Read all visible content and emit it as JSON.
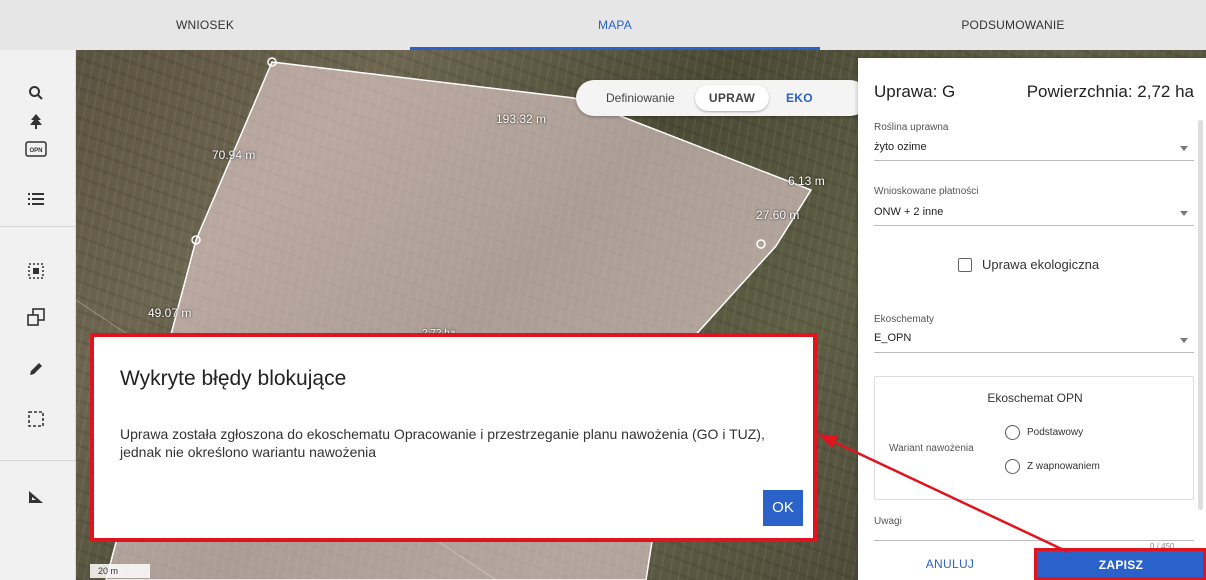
{
  "tabs": [
    {
      "label": "WNIOSEK"
    },
    {
      "label": "MAPA"
    },
    {
      "label": "PODSUMOWANIE"
    }
  ],
  "toolbar": {
    "icons": [
      "search-icon",
      "tree-icon",
      "opn-icon",
      "list-icon",
      "select-area-icon",
      "layers-copy-icon",
      "pencil-icon",
      "dashed-select-icon",
      "ruler-icon"
    ],
    "opn_label": "OPN"
  },
  "map": {
    "toggle": {
      "label": "Definiowanie",
      "upraw": "UPRAW",
      "eko": "EKO"
    },
    "measurements": [
      "193.32 m",
      "70.94 m",
      "6.13 m",
      "27.60 m",
      "49.07 m",
      "2.72 ha"
    ],
    "scale": "20 m"
  },
  "panel": {
    "title": "Uprawa: G",
    "area": "Powierzchnia: 2,72 ha",
    "crop_label": "Roślina uprawna",
    "crop_value": "żyto ozime",
    "payments_label": "Wnioskowane płatności",
    "payments_value": "ONW + 2 inne",
    "eco_checkbox_label": "Uprawa ekologiczna",
    "ecoschemes_label": "Ekoschematy",
    "ecoschemes_value": "E_OPN",
    "opn_box_title": "Ekoschemat OPN",
    "variant_label": "Wariant nawożenia",
    "variant_opt1": "Podstawowy",
    "variant_opt2": "Z wapnowaniem",
    "notes_label": "Uwagi",
    "counter": "0 / 450",
    "cancel": "ANULUJ",
    "save": "ZAPISZ"
  },
  "modal": {
    "title": "Wykryte błędy blokujące",
    "message": "Uprawa została zgłoszona do ekoschematu Opracowanie i przestrzeganie planu nawożenia (GO i TUZ), jednak nie określono wariantu nawożenia",
    "ok": "OK"
  },
  "colors": {
    "accent": "#2a62c9",
    "highlight": "#e0141e"
  }
}
